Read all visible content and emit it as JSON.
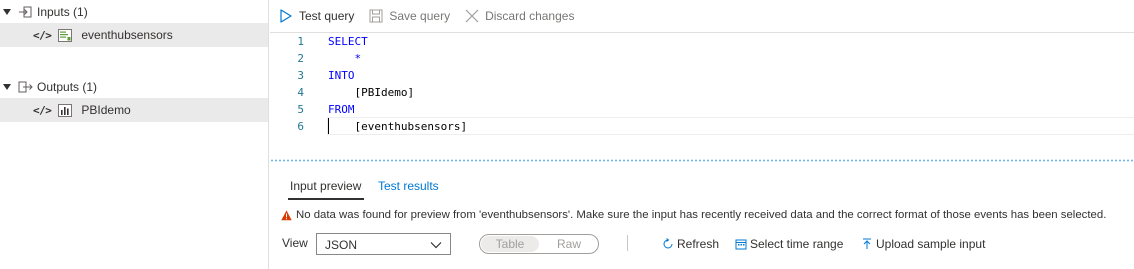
{
  "tree": {
    "inputs": {
      "group_label": "Inputs (1)",
      "icon": "input-arrow-icon",
      "items": [
        {
          "code_icon": "</>",
          "icon": "event-hub-icon",
          "label": "eventhubsensors"
        }
      ]
    },
    "outputs": {
      "group_label": "Outputs (1)",
      "icon": "output-arrow-icon",
      "items": [
        {
          "code_icon": "</>",
          "icon": "power-bi-icon",
          "label": "PBIdemo"
        }
      ]
    }
  },
  "toolbar": {
    "test_query": {
      "label": "Test query",
      "icon": "play-icon",
      "enabled": true
    },
    "save_query": {
      "label": "Save query",
      "icon": "save-icon",
      "enabled": false
    },
    "discard_changes": {
      "label": "Discard changes",
      "icon": "close-icon",
      "enabled": false
    }
  },
  "editor": {
    "lines": [
      {
        "number": "1",
        "text": "SELECT"
      },
      {
        "number": "2",
        "text": "    *"
      },
      {
        "number": "3",
        "text": "INTO"
      },
      {
        "number": "4",
        "text": "    [PBIdemo]"
      },
      {
        "number": "5",
        "text": "FROM"
      },
      {
        "number": "6",
        "text": "    [eventhubsensors]"
      }
    ]
  },
  "results": {
    "tabs": [
      {
        "label": "Input preview",
        "active": true
      },
      {
        "label": "Test results",
        "active": false
      }
    ],
    "warning": "No data was found for preview from 'eventhubsensors'. Make sure the input has recently received data and the correct format of those events has been selected.",
    "view_label": "View",
    "view_select": {
      "value": "JSON"
    },
    "toggle": {
      "left": "Table",
      "right": "Raw"
    },
    "buttons": {
      "refresh": {
        "label": "Refresh",
        "icon": "refresh-icon"
      },
      "select_time_range": {
        "label": "Select time range",
        "icon": "calendar-icon"
      },
      "upload_sample_input": {
        "label": "Upload sample input",
        "icon": "upload-icon"
      }
    }
  },
  "colors": {
    "keyword": "#0000ff",
    "line_number": "#237893",
    "link": "#0078d4",
    "selected_row": "#ebeaea",
    "warning": "#d83b01",
    "splitter": "#6fb7e6",
    "disabled_text": "#797775"
  }
}
